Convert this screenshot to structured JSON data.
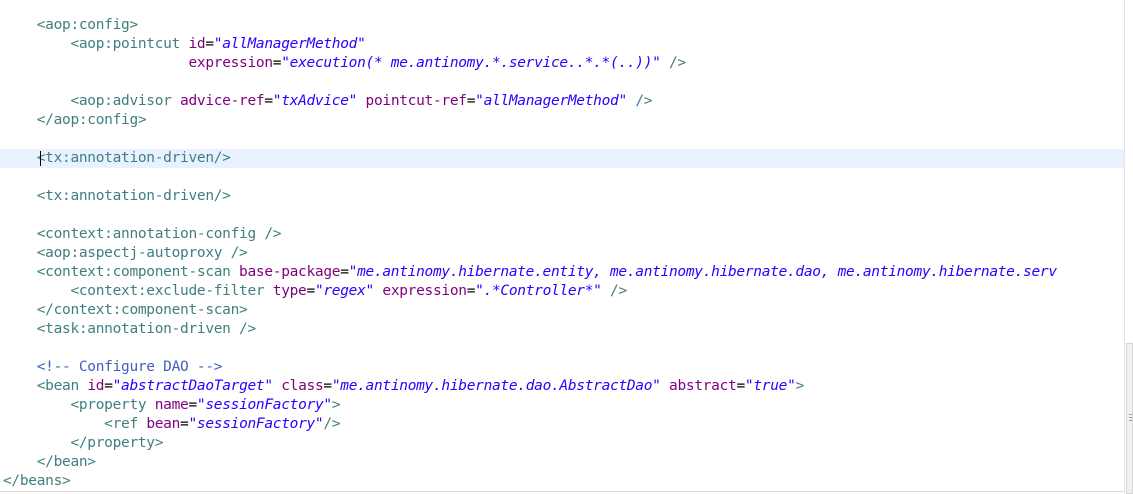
{
  "editor": {
    "lines": [
      [
        [
          "tag",
          "    <aop:config>"
        ]
      ],
      [
        [
          "tag",
          "        <aop:pointcut "
        ],
        [
          "attr",
          "id"
        ],
        [
          "eq",
          "="
        ],
        [
          "val",
          "\"allManagerMethod\""
        ]
      ],
      [
        [
          "tag",
          "                      "
        ],
        [
          "attr",
          "expression"
        ],
        [
          "eq",
          "="
        ],
        [
          "val",
          "\"execution(* me.antinomy.*.service..*.*(..))\""
        ],
        [
          "tag",
          " />"
        ]
      ],
      [],
      [
        [
          "tag",
          "        <aop:advisor "
        ],
        [
          "attr",
          "advice-ref"
        ],
        [
          "eq",
          "="
        ],
        [
          "val",
          "\"txAdvice\""
        ],
        [
          "tag",
          " "
        ],
        [
          "attr",
          "pointcut-ref"
        ],
        [
          "eq",
          "="
        ],
        [
          "val",
          "\"allManagerMethod\""
        ],
        [
          "tag",
          " />"
        ]
      ],
      [
        [
          "tag",
          "    </aop:config>"
        ]
      ],
      [],
      [
        [
          "tag",
          "    <tx:annotation-driven/>"
        ]
      ],
      [],
      [
        [
          "tag",
          "    <tx:annotation-driven/>"
        ]
      ],
      [],
      [
        [
          "tag",
          "    <context:annotation-config />"
        ]
      ],
      [
        [
          "tag",
          "    <aop:aspectj-autoproxy />"
        ]
      ],
      [
        [
          "tag",
          "    <context:component-scan "
        ],
        [
          "attr",
          "base-package"
        ],
        [
          "eq",
          "="
        ],
        [
          "val",
          "\"me.antinomy.hibernate.entity, me.antinomy.hibernate.dao, me.antinomy.hibernate.serv"
        ]
      ],
      [
        [
          "tag",
          "        <context:exclude-filter "
        ],
        [
          "attr",
          "type"
        ],
        [
          "eq",
          "="
        ],
        [
          "val",
          "\"regex\""
        ],
        [
          "tag",
          " "
        ],
        [
          "attr",
          "expression"
        ],
        [
          "eq",
          "="
        ],
        [
          "val",
          "\".*Controller*\""
        ],
        [
          "tag",
          " />"
        ]
      ],
      [
        [
          "tag",
          "    </context:component-scan>"
        ]
      ],
      [
        [
          "tag",
          "    <task:annotation-driven />"
        ]
      ],
      [],
      [
        [
          "comment",
          "    <!-- Configure DAO -->"
        ]
      ],
      [
        [
          "tag",
          "    <bean "
        ],
        [
          "attr",
          "id"
        ],
        [
          "eq",
          "="
        ],
        [
          "val",
          "\"abstractDaoTarget\""
        ],
        [
          "tag",
          " "
        ],
        [
          "attr",
          "class"
        ],
        [
          "eq",
          "="
        ],
        [
          "val",
          "\"me.antinomy.hibernate.dao.AbstractDao\""
        ],
        [
          "tag",
          " "
        ],
        [
          "attr",
          "abstract"
        ],
        [
          "eq",
          "="
        ],
        [
          "val",
          "\"true\""
        ],
        [
          "tag",
          ">"
        ]
      ],
      [
        [
          "tag",
          "        <property "
        ],
        [
          "attr",
          "name"
        ],
        [
          "eq",
          "="
        ],
        [
          "val",
          "\"sessionFactory\""
        ],
        [
          "tag",
          ">"
        ]
      ],
      [
        [
          "tag",
          "            <ref "
        ],
        [
          "attr",
          "bean"
        ],
        [
          "eq",
          "="
        ],
        [
          "val",
          "\"sessionFactory\""
        ],
        [
          "tag",
          "/>"
        ]
      ],
      [
        [
          "tag",
          "        </property>"
        ]
      ],
      [
        [
          "tag",
          "    </bean>"
        ]
      ],
      [
        [
          "tag",
          "</beans>"
        ]
      ]
    ],
    "current_line": 8,
    "colors": {
      "tag": "#3f7f7f",
      "attr": "#7f007f",
      "value": "#2a00ff",
      "comment": "#3f5fbf",
      "current_line_bg": "#e8f2fe"
    }
  }
}
